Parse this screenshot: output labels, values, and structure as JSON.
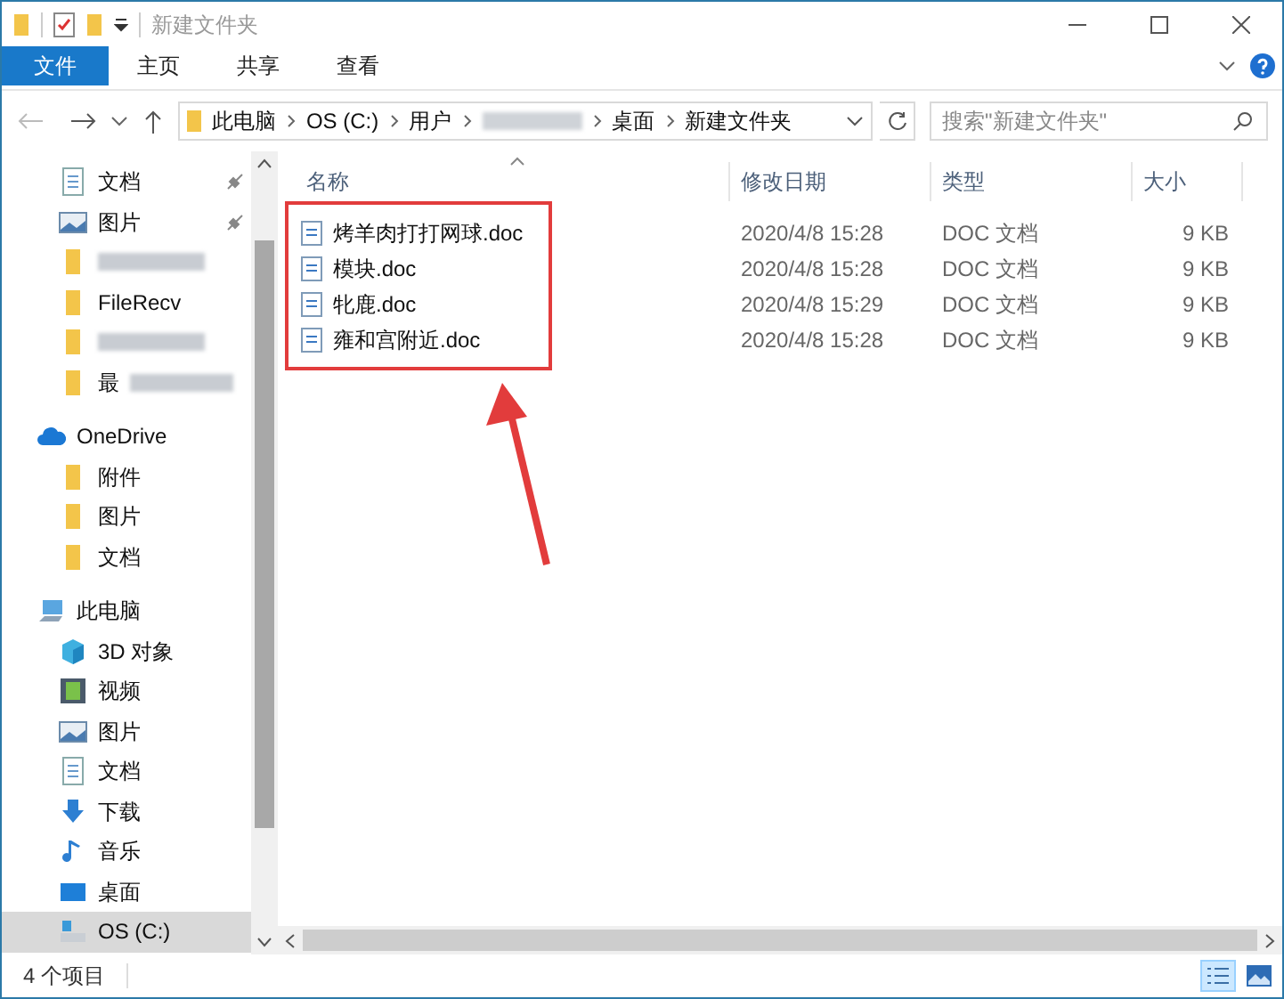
{
  "window": {
    "title": "新建文件夹"
  },
  "ribbon_tabs": [
    {
      "label": "文件",
      "selected": true
    },
    {
      "label": "主页",
      "selected": false
    },
    {
      "label": "共享",
      "selected": false
    },
    {
      "label": "查看",
      "selected": false
    }
  ],
  "breadcrumb": [
    {
      "label": "此电脑",
      "redacted": false
    },
    {
      "label": "OS (C:)",
      "redacted": false
    },
    {
      "label": "用户",
      "redacted": false
    },
    {
      "redacted": true
    },
    {
      "label": "桌面",
      "redacted": false
    },
    {
      "label": "新建文件夹",
      "redacted": false
    }
  ],
  "search": {
    "placeholder": "搜索\"新建文件夹\""
  },
  "sidebar": [
    {
      "kind": "doc",
      "label": "文档",
      "pinned": true,
      "selected": false,
      "indent": true,
      "redacted": false
    },
    {
      "kind": "picture",
      "label": "图片",
      "pinned": true,
      "selected": false,
      "indent": true,
      "redacted": false
    },
    {
      "kind": "folder",
      "pinned": false,
      "selected": false,
      "indent": true,
      "redacted": true
    },
    {
      "kind": "folder",
      "label": "FileRecv",
      "pinned": false,
      "selected": false,
      "indent": true,
      "redacted": false
    },
    {
      "kind": "folder",
      "pinned": false,
      "selected": false,
      "indent": true,
      "redacted": true
    },
    {
      "kind": "folder",
      "label": "最",
      "pinned": false,
      "selected": false,
      "indent": true,
      "redacted": true
    },
    {
      "kind": "cloud",
      "label": "OneDrive",
      "pinned": false,
      "selected": false,
      "indent": false,
      "redacted": false
    },
    {
      "kind": "folder",
      "label": "附件",
      "pinned": false,
      "selected": false,
      "indent": true,
      "redacted": false
    },
    {
      "kind": "folder",
      "label": "图片",
      "pinned": false,
      "selected": false,
      "indent": true,
      "redacted": false
    },
    {
      "kind": "folder",
      "label": "文档",
      "pinned": false,
      "selected": false,
      "indent": true,
      "redacted": false
    },
    {
      "kind": "pc",
      "label": "此电脑",
      "pinned": false,
      "selected": false,
      "indent": false,
      "redacted": false
    },
    {
      "kind": "cube",
      "label": "3D 对象",
      "pinned": false,
      "selected": false,
      "indent": true,
      "redacted": false
    },
    {
      "kind": "video",
      "label": "视频",
      "pinned": false,
      "selected": false,
      "indent": true,
      "redacted": false
    },
    {
      "kind": "picture",
      "label": "图片",
      "pinned": false,
      "selected": false,
      "indent": true,
      "redacted": false
    },
    {
      "kind": "doc",
      "label": "文档",
      "pinned": false,
      "selected": false,
      "indent": true,
      "redacted": false
    },
    {
      "kind": "download",
      "label": "下载",
      "pinned": false,
      "selected": false,
      "indent": true,
      "redacted": false
    },
    {
      "kind": "music",
      "label": "音乐",
      "pinned": false,
      "selected": false,
      "indent": true,
      "redacted": false
    },
    {
      "kind": "desktop",
      "label": "桌面",
      "pinned": false,
      "selected": false,
      "indent": true,
      "redacted": false
    },
    {
      "kind": "drive",
      "label": "OS (C:)",
      "pinned": false,
      "selected": true,
      "indent": true,
      "redacted": false
    }
  ],
  "table": {
    "columns": [
      "名称",
      "修改日期",
      "类型",
      "大小"
    ],
    "rows": [
      {
        "name": "烤羊肉打打网球.doc",
        "modified": "2020/4/8 15:28",
        "type": "DOC 文档",
        "size": "9 KB"
      },
      {
        "name": "模块.doc",
        "modified": "2020/4/8 15:28",
        "type": "DOC 文档",
        "size": "9 KB"
      },
      {
        "name": "牝鹿.doc",
        "modified": "2020/4/8 15:29",
        "type": "DOC 文档",
        "size": "9 KB"
      },
      {
        "name": "雍和宫附近.doc",
        "modified": "2020/4/8 15:28",
        "type": "DOC 文档",
        "size": "9 KB"
      }
    ]
  },
  "status_bar": {
    "item_count": "4 个项目"
  }
}
